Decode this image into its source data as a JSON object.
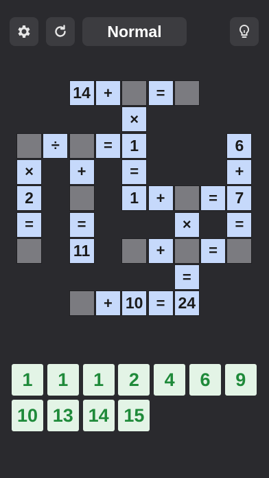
{
  "toolbar": {
    "difficulty_label": "Normal",
    "settings_icon": "gear-icon",
    "restart_icon": "refresh-icon",
    "hint_icon": "lightbulb-icon"
  },
  "colors": {
    "background": "#2a2a2e",
    "cell_fill": "#c6d9fb",
    "empty_cell": "#7b7b80",
    "tile_fill": "#e3f4e6",
    "tile_text": "#1f8a3a"
  },
  "board": {
    "cells": [
      {
        "row": 0,
        "col": 2,
        "t": "14"
      },
      {
        "row": 0,
        "col": 3,
        "t": "+"
      },
      {
        "row": 0,
        "col": 4,
        "t": ""
      },
      {
        "row": 0,
        "col": 5,
        "t": "="
      },
      {
        "row": 0,
        "col": 6,
        "t": ""
      },
      {
        "row": 1,
        "col": 4,
        "t": "×"
      },
      {
        "row": 2,
        "col": 0,
        "t": ""
      },
      {
        "row": 2,
        "col": 1,
        "t": "÷"
      },
      {
        "row": 2,
        "col": 2,
        "t": ""
      },
      {
        "row": 2,
        "col": 3,
        "t": "="
      },
      {
        "row": 2,
        "col": 4,
        "t": "1"
      },
      {
        "row": 2,
        "col": 8,
        "t": "6"
      },
      {
        "row": 3,
        "col": 0,
        "t": "×"
      },
      {
        "row": 3,
        "col": 2,
        "t": "+"
      },
      {
        "row": 3,
        "col": 4,
        "t": "="
      },
      {
        "row": 3,
        "col": 8,
        "t": "+"
      },
      {
        "row": 4,
        "col": 0,
        "t": "2"
      },
      {
        "row": 4,
        "col": 2,
        "t": ""
      },
      {
        "row": 4,
        "col": 4,
        "t": "1"
      },
      {
        "row": 4,
        "col": 5,
        "t": "+"
      },
      {
        "row": 4,
        "col": 6,
        "t": ""
      },
      {
        "row": 4,
        "col": 7,
        "t": "="
      },
      {
        "row": 4,
        "col": 8,
        "t": "7"
      },
      {
        "row": 5,
        "col": 0,
        "t": "="
      },
      {
        "row": 5,
        "col": 2,
        "t": "="
      },
      {
        "row": 5,
        "col": 6,
        "t": "×"
      },
      {
        "row": 5,
        "col": 8,
        "t": "="
      },
      {
        "row": 6,
        "col": 0,
        "t": ""
      },
      {
        "row": 6,
        "col": 2,
        "t": "11"
      },
      {
        "row": 6,
        "col": 4,
        "t": ""
      },
      {
        "row": 6,
        "col": 5,
        "t": "+"
      },
      {
        "row": 6,
        "col": 6,
        "t": ""
      },
      {
        "row": 6,
        "col": 7,
        "t": "="
      },
      {
        "row": 6,
        "col": 8,
        "t": ""
      },
      {
        "row": 7,
        "col": 6,
        "t": "="
      },
      {
        "row": 8,
        "col": 2,
        "t": ""
      },
      {
        "row": 8,
        "col": 3,
        "t": "+"
      },
      {
        "row": 8,
        "col": 4,
        "t": "10"
      },
      {
        "row": 8,
        "col": 5,
        "t": "="
      },
      {
        "row": 8,
        "col": 6,
        "t": "24"
      }
    ]
  },
  "tray": {
    "tiles": [
      "1",
      "1",
      "1",
      "2",
      "4",
      "6",
      "9",
      "10",
      "13",
      "14",
      "15"
    ]
  }
}
